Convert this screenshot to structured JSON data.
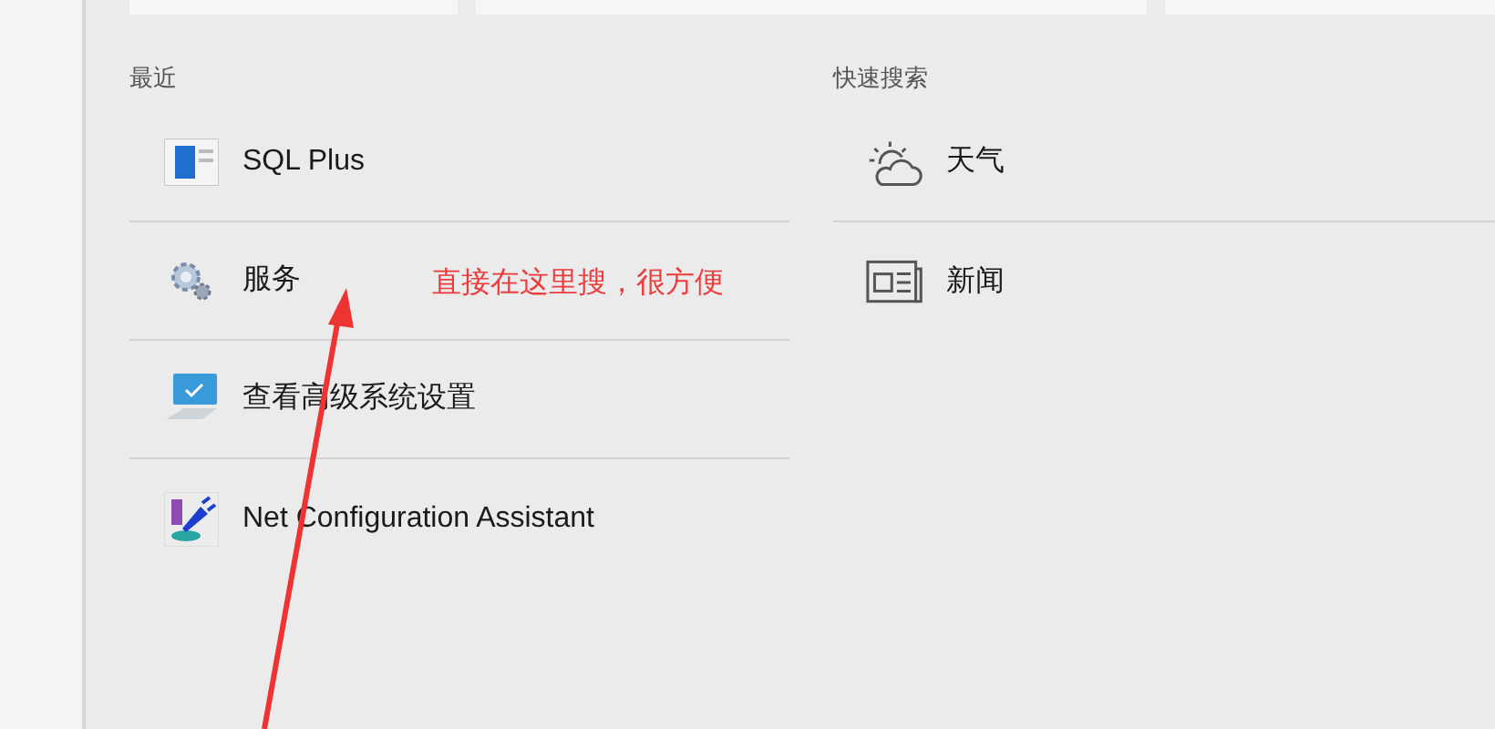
{
  "top_tiles": [
    {
      "kind": "tile"
    },
    {
      "kind": "tile"
    },
    {
      "kind": "tile"
    }
  ],
  "recent": {
    "title": "最近",
    "items": [
      {
        "kind": "sqlplus",
        "label": "SQL Plus"
      },
      {
        "kind": "services",
        "label": "服务"
      },
      {
        "kind": "system",
        "label": "查看高级系统设置"
      },
      {
        "kind": "netconfig",
        "label": "Net Configuration Assistant"
      }
    ]
  },
  "quick_search": {
    "title": "快速搜索",
    "items": [
      {
        "kind": "weather",
        "label": "天气"
      },
      {
        "kind": "news",
        "label": "新闻"
      }
    ]
  },
  "annotation": {
    "text": "直接在这里搜，很方便"
  }
}
